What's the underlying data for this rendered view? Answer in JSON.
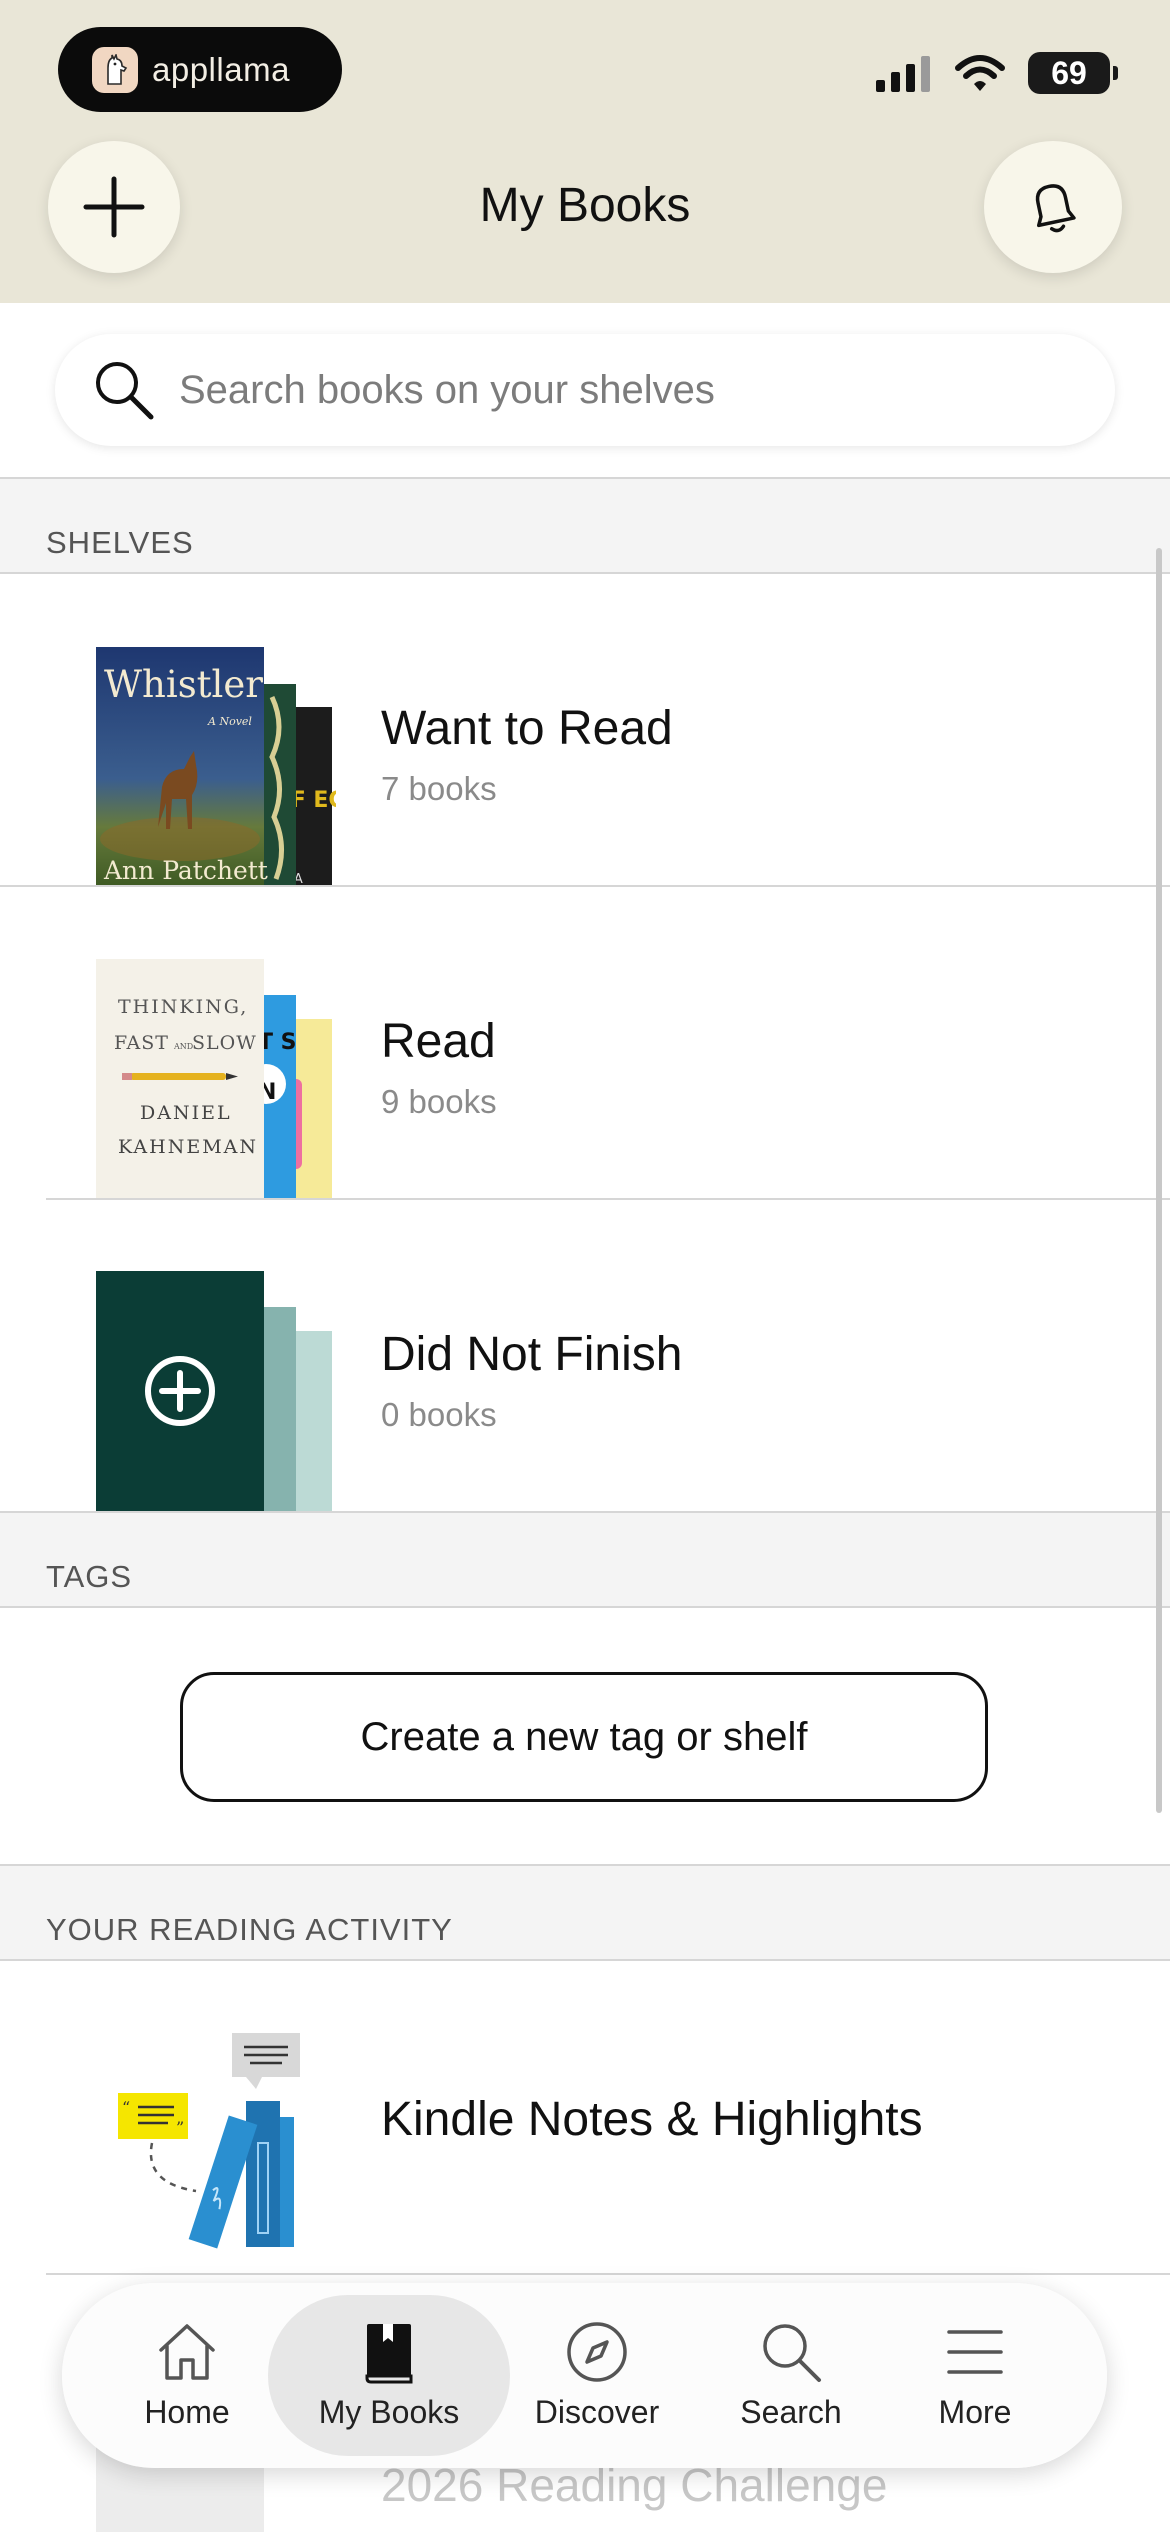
{
  "status_bar": {
    "app_pill": "appllama",
    "battery": "69"
  },
  "header": {
    "title": "My Books"
  },
  "search": {
    "placeholder": "Search books on your shelves"
  },
  "shelves_section": {
    "label": "SHELVES",
    "items": [
      {
        "name": "Want to Read",
        "count": "7 books",
        "cover_title": "Whistler",
        "cover_subtitle": "A Novel",
        "cover_author": "Ann Patchett",
        "spine_text": "OF EG",
        "spine_text2": "PATA"
      },
      {
        "name": "Read",
        "count": "9 books",
        "cover_title_1": "THINKING,",
        "cover_title_2": "FAST",
        "cover_title_and": "AND",
        "cover_title_3": "SLOW",
        "cover_author_1": "DANIEL",
        "cover_author_2": "KAHNEMAN",
        "spine_text": "T S",
        "spine_letter": "N"
      },
      {
        "name": "Did Not Finish",
        "count": "0 books"
      }
    ]
  },
  "tags_section": {
    "label": "TAGS",
    "create_button": "Create a new tag or shelf"
  },
  "activity_section": {
    "label": "YOUR READING ACTIVITY",
    "items": [
      {
        "name": "Kindle Notes & Highlights"
      },
      {
        "name": "2026 Reading Challenge"
      }
    ]
  },
  "tab_bar": {
    "tabs": [
      {
        "label": "Home",
        "icon": "home-icon"
      },
      {
        "label": "My Books",
        "icon": "book-icon",
        "active": true
      },
      {
        "label": "Discover",
        "icon": "compass-icon"
      },
      {
        "label": "Search",
        "icon": "search-icon"
      },
      {
        "label": "More",
        "icon": "menu-icon"
      }
    ]
  },
  "colors": {
    "header_bg": "#e9e6d7",
    "dnf_cover": "#0b3d36",
    "dnf_spine1": "#86b3ae",
    "dnf_spine2": "#bcdad5",
    "kindle_blue": "#2a8fd0",
    "highlight_yellow": "#f5e600"
  }
}
